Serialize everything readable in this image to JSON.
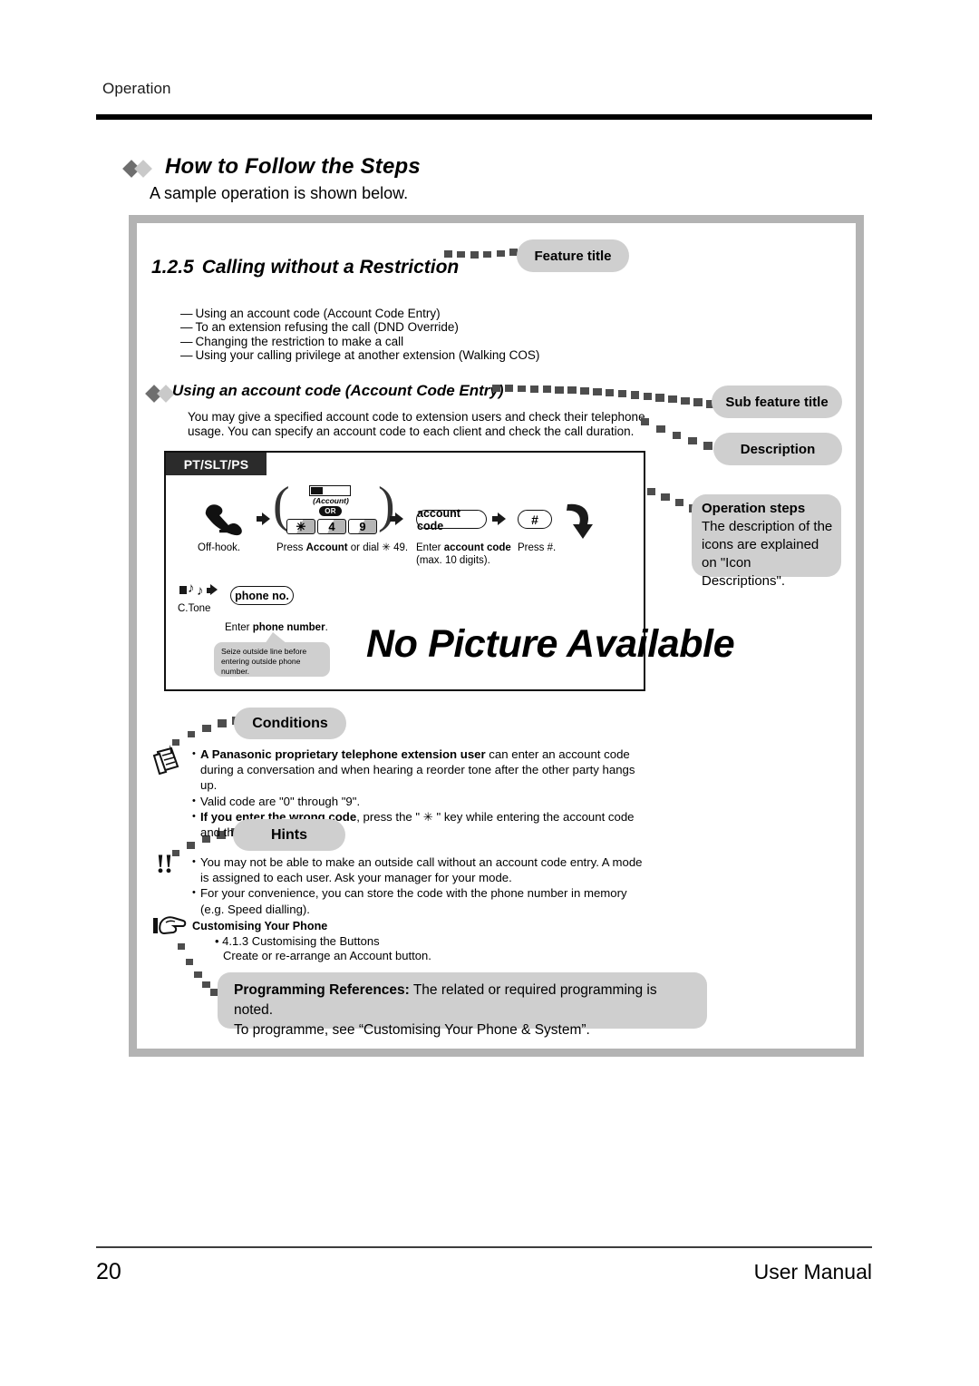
{
  "running_head": "Operation",
  "section": {
    "heading": "How to Follow the Steps",
    "subtitle": "A sample operation is shown below."
  },
  "feature": {
    "number": "1.2.5",
    "title": "Calling without a Restriction",
    "bullets": [
      "Using an account code (Account Code Entry)",
      "To an extension refusing the call (DND Override)",
      "Changing the restriction to make a call",
      "Using your calling privilege at another extension (Walking COS)"
    ],
    "dash": "—"
  },
  "sub_feature": {
    "title": "Using an account code (Account Code Entry)",
    "description": "You may give a specified account code to extension users and check their telephone usage. You can specify an account code to each client and check the call duration."
  },
  "callouts": {
    "feature_title": "Feature title",
    "sub_feature_title": "Sub feature title",
    "description": "Description",
    "operation_steps_title": "Operation steps",
    "operation_steps_body": "The description of the icons are explained on \"Icon Descriptions\".",
    "conditions": "Conditions",
    "hints": "Hints"
  },
  "diagram": {
    "phone_types": "PT/SLT/PS",
    "overlay_text": "No Picture Available",
    "account_key_caption": "(Account)",
    "or_badge": "OR",
    "keys": [
      "✳",
      "4",
      "9"
    ],
    "account_code_capsule": "account code",
    "hash_capsule": "#",
    "phone_no_capsule": "phone no.",
    "ctone_label": "C.Tone",
    "steps": [
      {
        "label_plain": "Off-hook."
      },
      {
        "label_pre": "Press ",
        "label_bold": "Account",
        "label_post": " or dial ✳ 49."
      },
      {
        "label_pre": "Enter ",
        "label_bold": "account code",
        "label_post": "",
        "label_line2": "(max. 10 digits)."
      },
      {
        "label_plain": "Press #."
      },
      {
        "label_pre": "Enter ",
        "label_bold": "phone number",
        "label_post": "."
      }
    ],
    "bubble": "Seize outside line before entering outside phone number."
  },
  "conditions_items": [
    {
      "bold": "A Panasonic proprietary telephone extension user",
      "rest": " can enter an account code during a conversation and when hearing a reorder tone after the other party hangs up."
    },
    {
      "bold": "",
      "rest": "Valid code are \"0\" through \"9\"."
    },
    {
      "bold": "If you enter the wrong code",
      "rest": ", press the \" ✳ \" key while entering the account code and then re-enter the code."
    }
  ],
  "hints_items": [
    {
      "bold": "",
      "rest": "You may not be able to make an outside call without an account code entry. A mode is assigned to each user. Ask your manager for  your mode."
    },
    {
      "bold": "",
      "rest": "For your convenience, you can store the code with the phone number in memory (e.g. Speed dialling)."
    }
  ],
  "customising": {
    "title": "Customising Your Phone",
    "line1": "• 4.1.3 Customising the Buttons",
    "line2": "Create or re-arrange an Account button."
  },
  "programming_references": {
    "label": "Programming References:",
    "text1": " The related or required programming is noted.",
    "text2": "To programme, see “Customising Your Phone & System”."
  },
  "footer": {
    "page_number": "20",
    "manual_label": "User Manual"
  },
  "colors": {
    "pill_gray": "#cfcfcf",
    "frame_gray": "#b3b3b3",
    "rule_black": "#000000",
    "tab_dark": "#2b2b2b"
  }
}
